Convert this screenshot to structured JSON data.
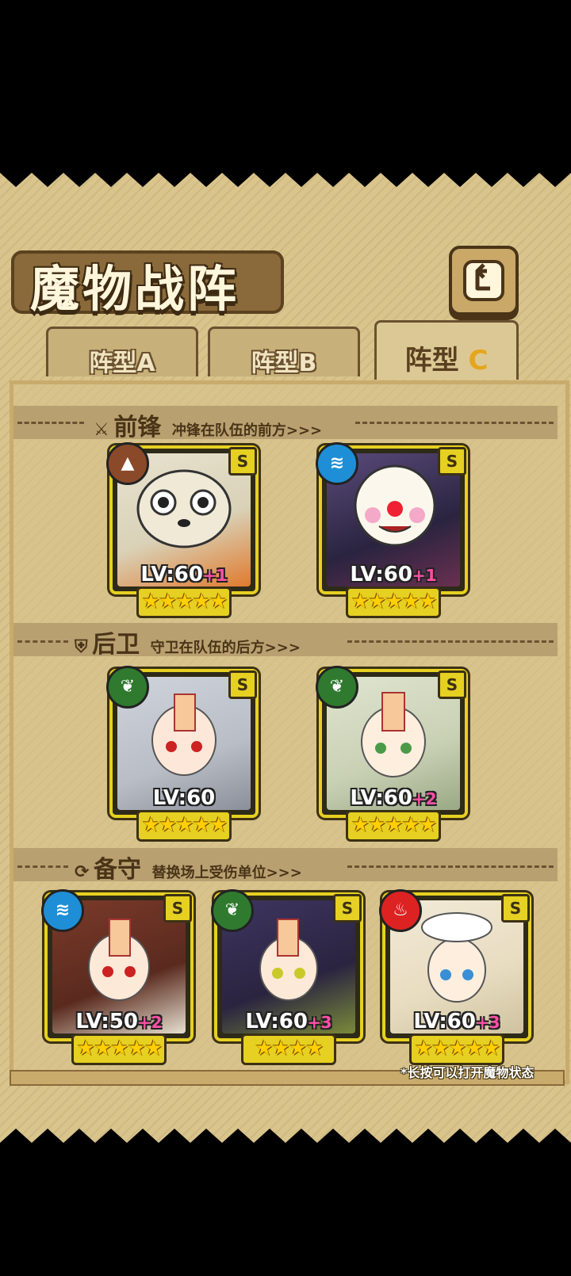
{
  "header": {
    "title": "魔物战阵"
  },
  "tabs": [
    {
      "label": "阵型A",
      "active": false
    },
    {
      "label": "阵型B",
      "active": false
    },
    {
      "label_main": "阵型",
      "label_letter": "C",
      "active": true
    }
  ],
  "sections": {
    "front": {
      "title": "前锋",
      "desc": "冲锋在队伍的前方>>>"
    },
    "back": {
      "title": "后卫",
      "desc": "守卫在队伍的后方>>>"
    },
    "reserve": {
      "title": "备守",
      "desc": "替换场上受伤单位>>>"
    }
  },
  "cards": {
    "front1": {
      "level": "LV:60",
      "plus": "+1",
      "rank": "S",
      "stars": "★★★★★",
      "element": "earth-icon"
    },
    "front2": {
      "level": "LV:60",
      "plus": "+1",
      "rank": "S",
      "stars": "★★★★★",
      "element": "water-icon"
    },
    "back1": {
      "level": "LV:60",
      "plus": "",
      "rank": "S",
      "stars": "★★★★★",
      "element": "leaf-icon"
    },
    "back2": {
      "level": "LV:60",
      "plus": "+2",
      "rank": "S",
      "stars": "★★★★★",
      "element": "leaf-icon"
    },
    "res1": {
      "level": "LV:50",
      "plus": "+2",
      "rank": "S",
      "stars": "★★★★★",
      "element": "water-icon"
    },
    "res2": {
      "level": "LV:60",
      "plus": "+3",
      "rank": "S",
      "stars": "★★★★",
      "element": "leaf-icon"
    },
    "res3": {
      "level": "LV:60",
      "plus": "+3",
      "rank": "S",
      "stars": "★★★★★",
      "element": "fire-icon"
    }
  },
  "footer": {
    "note": "*长按可以打开魔物状态"
  },
  "colors": {
    "panel": "#d9c48c",
    "gold_frame": "#e6d021",
    "dark_brown": "#3c3114",
    "plus_pink": "#ff4fa6"
  }
}
